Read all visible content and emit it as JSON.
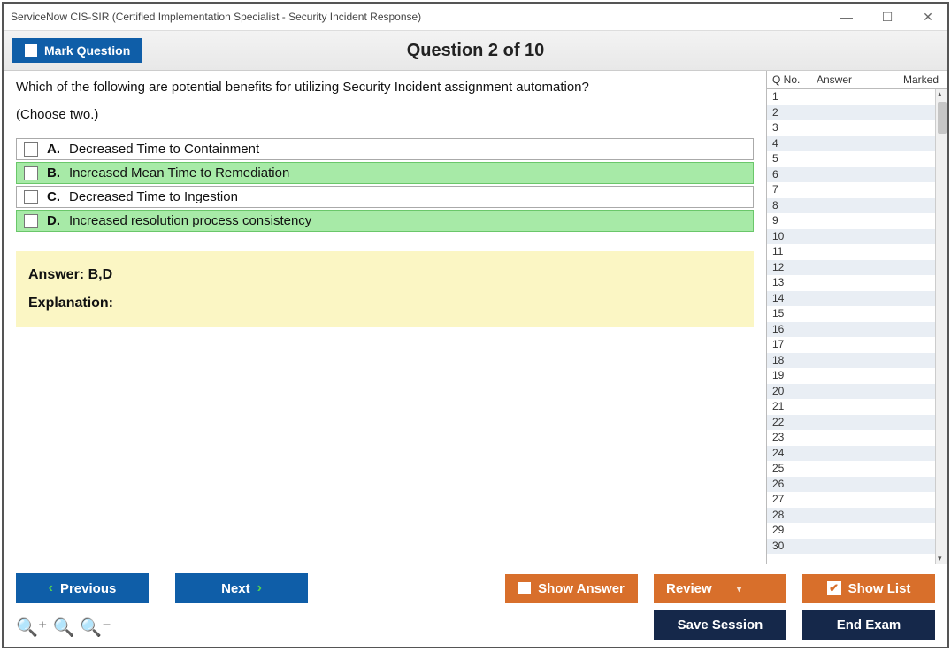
{
  "window": {
    "title": "ServiceNow CIS-SIR (Certified Implementation Specialist - Security Incident Response)"
  },
  "header": {
    "mark_label": "Mark Question",
    "heading": "Question 2 of 10"
  },
  "question": {
    "text": "Which of the following are potential benefits for utilizing Security Incident assignment automation?",
    "choose": "(Choose two.)",
    "choices": [
      {
        "letter": "A.",
        "text": "Decreased Time to Containment",
        "correct": false
      },
      {
        "letter": "B.",
        "text": "Increased Mean Time to Remediation",
        "correct": true
      },
      {
        "letter": "C.",
        "text": "Decreased Time to Ingestion",
        "correct": false
      },
      {
        "letter": "D.",
        "text": "Increased resolution process consistency",
        "correct": true
      }
    ]
  },
  "answer_box": {
    "answer_label": "Answer: B,D",
    "explanation_label": "Explanation:"
  },
  "list": {
    "cols": {
      "qno": "Q No.",
      "ans": "Answer",
      "marked": "Marked"
    },
    "current": 2,
    "count": 30
  },
  "footer": {
    "previous": "Previous",
    "next": "Next",
    "show_answer": "Show Answer",
    "review": "Review",
    "show_list": "Show List",
    "save": "Save Session",
    "end": "End Exam"
  }
}
